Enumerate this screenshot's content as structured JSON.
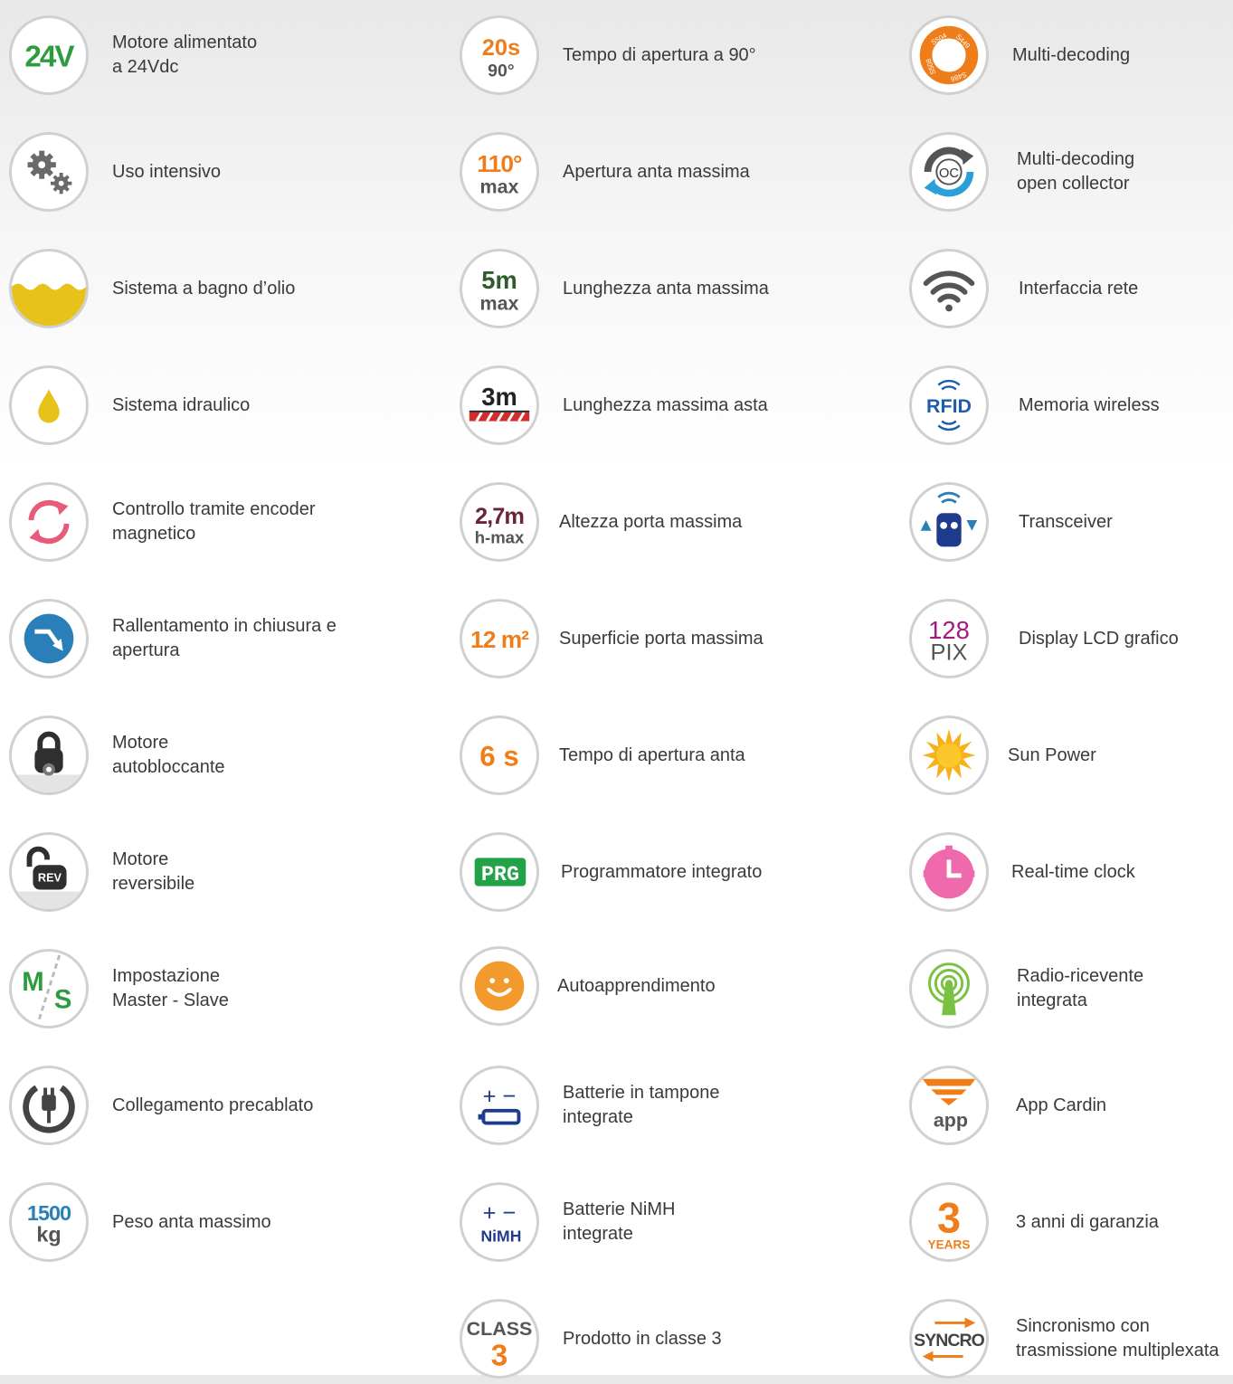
{
  "columns": [
    {
      "items": [
        {
          "label": "Motore alimentato\na 24Vdc",
          "icon": "24v-power-icon",
          "icon_text": "24V"
        },
        {
          "label": "Uso intensivo",
          "icon": "gears-icon"
        },
        {
          "label": "Sistema a bagno d’olio",
          "icon": "oil-bath-icon"
        },
        {
          "label": "Sistema idraulico",
          "icon": "hydraulic-drop-icon"
        },
        {
          "label": "Controllo tramite encoder\nmagnetico",
          "icon": "encoder-cycle-icon"
        },
        {
          "label": "Rallentamento in chiusura e\napertura",
          "icon": "slowdown-arrow-icon"
        },
        {
          "label": "Motore\nautobloccante",
          "icon": "padlock-gear-icon"
        },
        {
          "label": "Motore\nreversibile",
          "icon": "rev-padlock-icon",
          "icon_text": "REV"
        },
        {
          "label": "Impostazione\nMaster - Slave",
          "icon": "master-slave-icon",
          "icon_text_a": "M",
          "icon_text_b": "S"
        },
        {
          "label": "Collegamento precablato",
          "icon": "plug-icon"
        },
        {
          "label": "Peso anta massimo",
          "icon": "weight-icon",
          "icon_text_a": "1500",
          "icon_text_b": "kg"
        }
      ]
    },
    {
      "items": [
        {
          "label": "Tempo di apertura a 90°",
          "icon": "opening-time-90-icon",
          "icon_text_a": "20s",
          "icon_text_b": "90°"
        },
        {
          "label": "Apertura anta massima",
          "icon": "max-angle-icon",
          "icon_text_a": "110°",
          "icon_text_b": "max"
        },
        {
          "label": "Lunghezza anta massima",
          "icon": "max-leaf-length-icon",
          "icon_text_a": "5m",
          "icon_text_b": "max"
        },
        {
          "label": "Lunghezza massima asta",
          "icon": "max-boom-length-icon",
          "icon_text_a": "3m"
        },
        {
          "label": "Altezza porta massima",
          "icon": "max-door-height-icon",
          "icon_text_a": "2,7m",
          "icon_text_b": "h-max"
        },
        {
          "label": "Superficie porta massima",
          "icon": "max-door-area-icon",
          "icon_text_a": "12 m²"
        },
        {
          "label": "Tempo di apertura anta",
          "icon": "leaf-opening-time-icon",
          "icon_text_a": "6 s"
        },
        {
          "label": "Programmatore integrato",
          "icon": "programmer-icon",
          "icon_text_a": "PRG"
        },
        {
          "label": "Autoapprendimento",
          "icon": "smiley-icon"
        },
        {
          "label": "Batterie in tampone\nintegrate",
          "icon": "backup-battery-icon",
          "icon_text_a": "+ −"
        },
        {
          "label": "Batterie NiMH\nintegrate",
          "icon": "nimh-battery-icon",
          "icon_text_a": "+ −",
          "icon_text_b": "NiMH"
        },
        {
          "label": "Prodotto in classe 3",
          "icon": "class-3-icon",
          "icon_text_a": "CLASS",
          "icon_text_b": "3"
        }
      ]
    },
    {
      "items": [
        {
          "label": "Multi-decoding",
          "icon": "multi-decoding-icon",
          "icon_text_a": "S504",
          "icon_text_b": "S449",
          "icon_text_c": "S486",
          "icon_text_d": "S508"
        },
        {
          "label": "Multi-decoding\nopen collector",
          "icon": "open-collector-icon",
          "icon_text_a": "OC"
        },
        {
          "label": "Interfaccia rete",
          "icon": "wifi-icon"
        },
        {
          "label": "Memoria wireless",
          "icon": "rfid-icon",
          "icon_text_a": "RFID"
        },
        {
          "label": "Transceiver",
          "icon": "transceiver-icon"
        },
        {
          "label": "Display LCD grafico",
          "icon": "lcd-display-icon",
          "icon_text_a": "128",
          "icon_text_b": "PIX"
        },
        {
          "label": "Sun Power",
          "icon": "sun-icon"
        },
        {
          "label": "Real-time clock",
          "icon": "clock-icon"
        },
        {
          "label": "Radio-ricevente\nintegrata",
          "icon": "antenna-icon"
        },
        {
          "label": "App Cardin",
          "icon": "app-cardin-icon",
          "icon_text_a": "app"
        },
        {
          "label": "3 anni di garanzia",
          "icon": "warranty-icon",
          "icon_text_a": "3",
          "icon_text_b": "YEARS"
        },
        {
          "label": "Sincronismo con\ntrasmissione multiplexata",
          "icon": "syncro-icon",
          "icon_text_a": "SYNCRO"
        }
      ]
    }
  ],
  "colors": {
    "green": "#2e9c3e",
    "orange": "#ef7d1a",
    "gray": "#555555",
    "yellow": "#e6c21a",
    "pink": "#e85a7a",
    "blue": "#2a7fb9",
    "navy": "#1f3c8c",
    "maroon": "#6b2436"
  }
}
